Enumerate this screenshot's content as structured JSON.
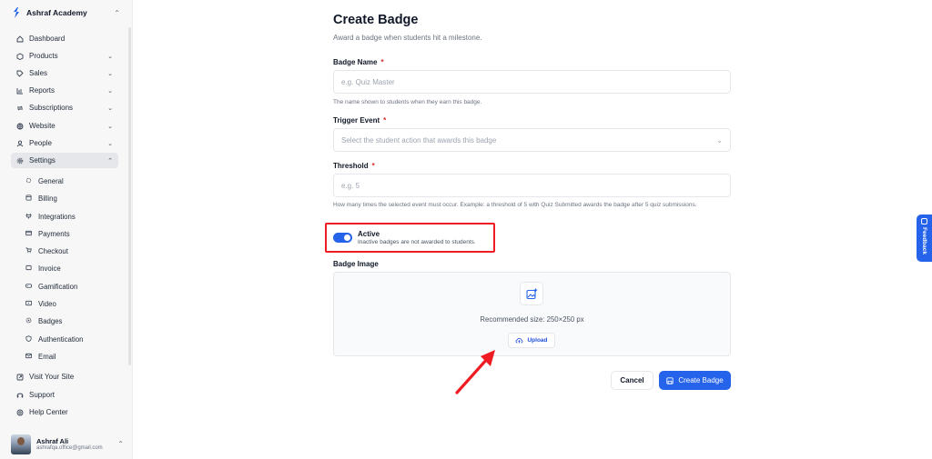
{
  "sidebar": {
    "brand": "Ashraf Academy",
    "nav": [
      {
        "label": "Dashboard",
        "icon": "home-icon"
      },
      {
        "label": "Products",
        "icon": "box-icon"
      },
      {
        "label": "Sales",
        "icon": "tag-icon"
      },
      {
        "label": "Reports",
        "icon": "bar-chart-icon"
      },
      {
        "label": "Subscriptions",
        "icon": "repeat-icon"
      },
      {
        "label": "Website",
        "icon": "globe-icon"
      },
      {
        "label": "People",
        "icon": "user-icon"
      },
      {
        "label": "Settings",
        "icon": "gear-icon"
      }
    ],
    "settings_items": [
      {
        "label": "General",
        "icon": "gear-icon"
      },
      {
        "label": "Billing",
        "icon": "billing-icon"
      },
      {
        "label": "Integrations",
        "icon": "plug-icon"
      },
      {
        "label": "Payments",
        "icon": "card-icon"
      },
      {
        "label": "Checkout",
        "icon": "cart-icon"
      },
      {
        "label": "Invoice",
        "icon": "invoice-icon"
      },
      {
        "label": "Gamification",
        "icon": "gamepad-icon"
      },
      {
        "label": "Video",
        "icon": "video-icon"
      },
      {
        "label": "Badges",
        "icon": "badge-icon"
      },
      {
        "label": "Authentication",
        "icon": "shield-icon"
      },
      {
        "label": "Email",
        "icon": "mail-icon"
      }
    ],
    "footer_links": [
      {
        "label": "Visit Your Site",
        "icon": "external-icon"
      },
      {
        "label": "Support",
        "icon": "headset-icon"
      },
      {
        "label": "Help Center",
        "icon": "help-icon"
      }
    ],
    "user": {
      "name": "Ashraf Ali",
      "email": "ashrafqa.office@gmail.com"
    }
  },
  "form": {
    "title": "Create Badge",
    "subtitle": "Award a badge when students hit a milestone.",
    "badge_name": {
      "label": "Badge Name",
      "placeholder": "e.g. Quiz Master",
      "help": "The name shown to students when they earn this badge."
    },
    "trigger_event": {
      "label": "Trigger Event",
      "placeholder": "Select the student action that awards this badge"
    },
    "threshold": {
      "label": "Threshold",
      "placeholder": "e.g. 5",
      "help": "How many times the selected event must occur. Example: a threshold of 5 with Quiz Submitted awards the badge after 5 quiz submissions."
    },
    "active": {
      "label": "Active",
      "description": "Inactive badges are not awarded to students.",
      "enabled": true
    },
    "badge_image": {
      "label": "Badge Image",
      "recommended": "Recommended size: 250×250 px",
      "upload_label": "Upload"
    },
    "required_mark": "*",
    "cancel_label": "Cancel",
    "submit_label": "Create Badge"
  },
  "feedback_label": "Feedback",
  "colors": {
    "accent": "#2563eb",
    "highlight": "#ef1c24",
    "required": "#dc2626"
  }
}
